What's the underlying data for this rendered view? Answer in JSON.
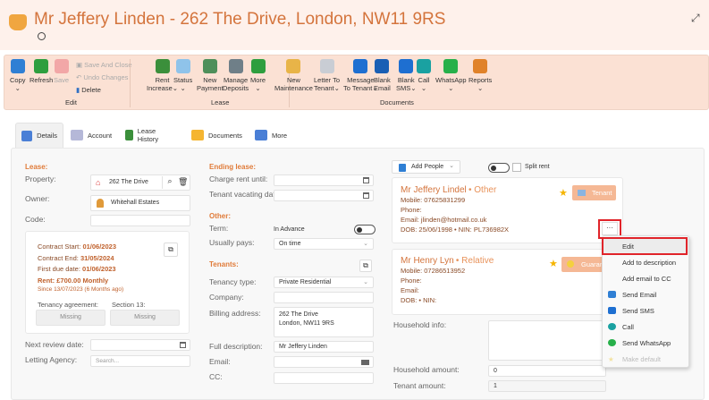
{
  "header": {
    "title": "Mr Jeffery Linden - 262 The Drive, London, NW11 9RS"
  },
  "ribbon": {
    "groups": [
      "Edit",
      "Lease",
      "Documents"
    ],
    "buttons": [
      {
        "id": "copy",
        "label": "Copy",
        "sub": "⌄",
        "color": "#2f7fd4"
      },
      {
        "id": "refresh",
        "label": "Refresh",
        "sub": "",
        "color": "#2e9e3e"
      },
      {
        "id": "save",
        "label": "Save",
        "sub": "",
        "color": "#f2a7a7",
        "disabled": true
      },
      {
        "id": "rent-increase",
        "label": "Rent",
        "sub": "Increase⌄",
        "color": "#3b8f3b"
      },
      {
        "id": "status",
        "label": "Status",
        "sub": "⌄",
        "color": "#8fc3ea"
      },
      {
        "id": "new-payment",
        "label": "New",
        "sub": "Payment",
        "color": "#4e8f5a"
      },
      {
        "id": "manage-deposits",
        "label": "Manage",
        "sub": "Deposits",
        "color": "#6f7f88"
      },
      {
        "id": "more",
        "label": "More",
        "sub": "⌄",
        "color": "#2e9e3e"
      },
      {
        "id": "new-maintenance",
        "label": "New",
        "sub": "Maintenance",
        "color": "#e8b448"
      },
      {
        "id": "letter-to-tenant",
        "label": "Letter To",
        "sub": "Tenant⌄",
        "color": "#c9cdd4"
      },
      {
        "id": "message-to-tenant",
        "label": "Message",
        "sub": "To Tenant⌄",
        "color": "#1e6fd1"
      },
      {
        "id": "blank-email",
        "label": "Blank",
        "sub": "Email",
        "color": "#1a5fb4"
      },
      {
        "id": "blank-sms",
        "label": "Blank",
        "sub": "SMS⌄",
        "color": "#1e6fd1"
      },
      {
        "id": "call",
        "label": "Call",
        "sub": "⌄",
        "color": "#1aa1a1"
      },
      {
        "id": "whatsapp",
        "label": "WhatsApp",
        "sub": "⌄",
        "color": "#27b04a"
      },
      {
        "id": "reports",
        "label": "Reports",
        "sub": "⌄",
        "color": "#e0822a"
      }
    ],
    "save_and_close": "Save And Close",
    "undo_changes": "Undo Changes",
    "delete": "Delete"
  },
  "tabs": [
    "Details",
    "Account",
    "Lease History",
    "Documents",
    "More"
  ],
  "lease": {
    "section": "Lease:",
    "property_label": "Property:",
    "property": "262 The Drive",
    "owner_label": "Owner:",
    "owner": "Whitehall Estates",
    "code_label": "Code:",
    "code": "",
    "contract_start_label": "Contract Start:",
    "contract_start": "01/06/2023",
    "contract_end_label": "Contract End:",
    "contract_end": "31/05/2024",
    "first_due_label": "First due date:",
    "first_due": "01/06/2023",
    "rent_label": "Rent:",
    "rent": "£700.00",
    "rent_freq": "Monthly",
    "since": "Since 13/07/2023 (6 Months ago)",
    "tenancy_agreement_label": "Tenancy agreement:",
    "tenancy_agreement": "Missing",
    "section13_label": "Section 13:",
    "section13": "Missing",
    "next_review_label": "Next review date:",
    "letting_agency_label": "Letting Agency:",
    "letting_agency_placeholder": "Search..."
  },
  "ending": {
    "section": "Ending lease:",
    "charge_label": "Charge rent until:",
    "vacating_label": "Tenant vacating dat"
  },
  "other": {
    "section": "Other:",
    "term_label": "Term:",
    "term": "In Advance",
    "pays_label": "Usually pays:",
    "pays": "On time"
  },
  "tenants": {
    "section": "Tenants:",
    "type_label": "Tenancy type:",
    "type": "Private Residential",
    "company_label": "Company:",
    "billing_label": "Billing address:",
    "billing_line1": "262 The Drive",
    "billing_line2": "London, NW11 9RS",
    "desc_label": "Full description:",
    "desc": "Mr Jeffery Linden",
    "email_label": "Email:",
    "cc_label": "CC:"
  },
  "people": {
    "add_people": "Add People",
    "split_rent": "Split rent",
    "list": [
      {
        "name": "Mr Jeffery Lindel",
        "relation": "• Other",
        "mobile": "Mobile: 07625831299",
        "phone": "Phone:",
        "email": "Email: jlinden@hotmail.co.uk",
        "dob": "DOB: 25/06/1998  • NIN: PL736982X",
        "role": "Tenant"
      },
      {
        "name": "Mr Henry Lyn",
        "relation": "• Relative",
        "mobile": "Mobile: 07286513952",
        "phone": "Phone:",
        "email": "Email:",
        "dob": "DOB:   • NIN:",
        "role": "Guarantor"
      }
    ],
    "more_button": "···",
    "household_info_label": "Household info:",
    "household_amount_label": "Household amount:",
    "household_amount": "0",
    "tenant_amount_label": "Tenant amount:",
    "tenant_amount": "1"
  },
  "menu": [
    "Edit",
    "Add to description",
    "Add email to CC",
    "Send Email",
    "Send SMS",
    "Call",
    "Send WhatsApp",
    "Make default"
  ]
}
